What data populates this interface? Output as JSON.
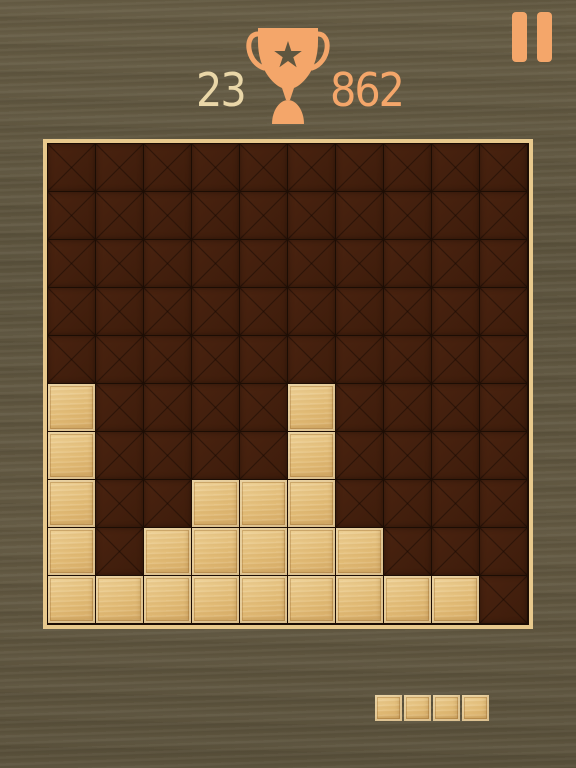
{
  "header": {
    "current_score": "23",
    "best_score": "862",
    "trophy_icon": "trophy-icon",
    "pause_icon": "pause-icon",
    "accent_color": "#f4a66a",
    "score_color": "#ead7a8"
  },
  "board": {
    "rows": 10,
    "cols": 10,
    "filled_cells": [
      [
        5,
        0
      ],
      [
        5,
        5
      ],
      [
        6,
        0
      ],
      [
        6,
        5
      ],
      [
        7,
        0
      ],
      [
        7,
        3
      ],
      [
        7,
        4
      ],
      [
        7,
        5
      ],
      [
        8,
        0
      ],
      [
        8,
        2
      ],
      [
        8,
        3
      ],
      [
        8,
        4
      ],
      [
        8,
        5
      ],
      [
        8,
        6
      ],
      [
        9,
        0
      ],
      [
        9,
        1
      ],
      [
        9,
        2
      ],
      [
        9,
        3
      ],
      [
        9,
        4
      ],
      [
        9,
        5
      ],
      [
        9,
        6
      ],
      [
        9,
        7
      ],
      [
        9,
        8
      ]
    ],
    "empty_color": "#3d1c0b",
    "block_color": "#e3bd78",
    "frame_color": "#e8c98d"
  },
  "next_piece": {
    "shape": "horizontal-1x4",
    "cells": 4
  }
}
